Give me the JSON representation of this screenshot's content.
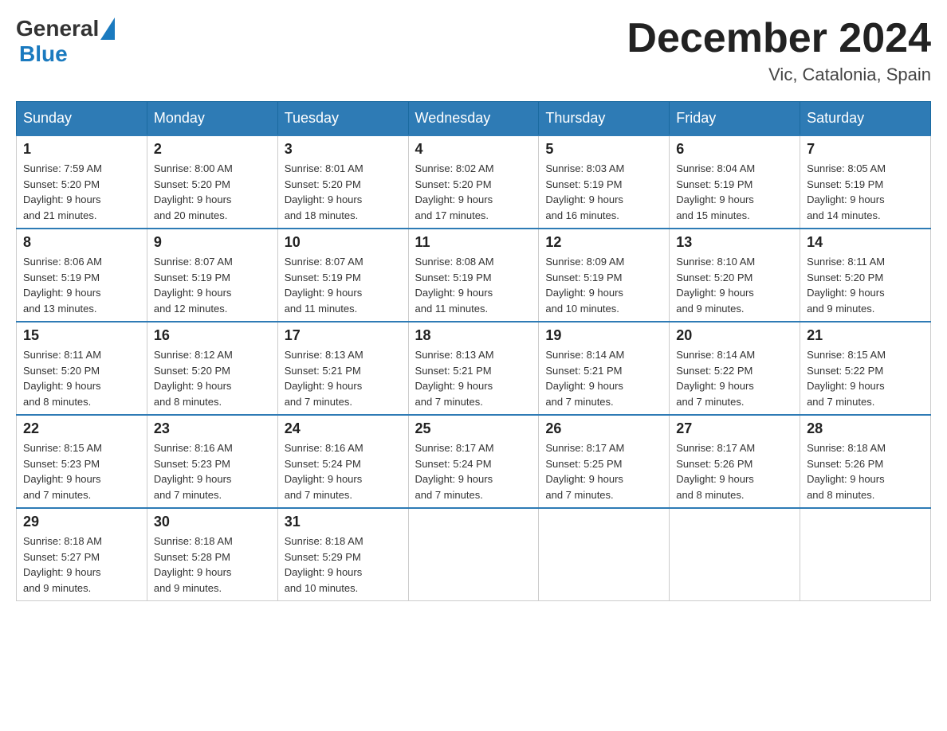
{
  "header": {
    "logo_general": "General",
    "logo_blue": "Blue",
    "month_title": "December 2024",
    "subtitle": "Vic, Catalonia, Spain"
  },
  "weekdays": [
    "Sunday",
    "Monday",
    "Tuesday",
    "Wednesday",
    "Thursday",
    "Friday",
    "Saturday"
  ],
  "weeks": [
    [
      {
        "day": "1",
        "sunrise": "7:59 AM",
        "sunset": "5:20 PM",
        "daylight": "9 hours and 21 minutes."
      },
      {
        "day": "2",
        "sunrise": "8:00 AM",
        "sunset": "5:20 PM",
        "daylight": "9 hours and 20 minutes."
      },
      {
        "day": "3",
        "sunrise": "8:01 AM",
        "sunset": "5:20 PM",
        "daylight": "9 hours and 18 minutes."
      },
      {
        "day": "4",
        "sunrise": "8:02 AM",
        "sunset": "5:20 PM",
        "daylight": "9 hours and 17 minutes."
      },
      {
        "day": "5",
        "sunrise": "8:03 AM",
        "sunset": "5:19 PM",
        "daylight": "9 hours and 16 minutes."
      },
      {
        "day": "6",
        "sunrise": "8:04 AM",
        "sunset": "5:19 PM",
        "daylight": "9 hours and 15 minutes."
      },
      {
        "day": "7",
        "sunrise": "8:05 AM",
        "sunset": "5:19 PM",
        "daylight": "9 hours and 14 minutes."
      }
    ],
    [
      {
        "day": "8",
        "sunrise": "8:06 AM",
        "sunset": "5:19 PM",
        "daylight": "9 hours and 13 minutes."
      },
      {
        "day": "9",
        "sunrise": "8:07 AM",
        "sunset": "5:19 PM",
        "daylight": "9 hours and 12 minutes."
      },
      {
        "day": "10",
        "sunrise": "8:07 AM",
        "sunset": "5:19 PM",
        "daylight": "9 hours and 11 minutes."
      },
      {
        "day": "11",
        "sunrise": "8:08 AM",
        "sunset": "5:19 PM",
        "daylight": "9 hours and 11 minutes."
      },
      {
        "day": "12",
        "sunrise": "8:09 AM",
        "sunset": "5:19 PM",
        "daylight": "9 hours and 10 minutes."
      },
      {
        "day": "13",
        "sunrise": "8:10 AM",
        "sunset": "5:20 PM",
        "daylight": "9 hours and 9 minutes."
      },
      {
        "day": "14",
        "sunrise": "8:11 AM",
        "sunset": "5:20 PM",
        "daylight": "9 hours and 9 minutes."
      }
    ],
    [
      {
        "day": "15",
        "sunrise": "8:11 AM",
        "sunset": "5:20 PM",
        "daylight": "9 hours and 8 minutes."
      },
      {
        "day": "16",
        "sunrise": "8:12 AM",
        "sunset": "5:20 PM",
        "daylight": "9 hours and 8 minutes."
      },
      {
        "day": "17",
        "sunrise": "8:13 AM",
        "sunset": "5:21 PM",
        "daylight": "9 hours and 7 minutes."
      },
      {
        "day": "18",
        "sunrise": "8:13 AM",
        "sunset": "5:21 PM",
        "daylight": "9 hours and 7 minutes."
      },
      {
        "day": "19",
        "sunrise": "8:14 AM",
        "sunset": "5:21 PM",
        "daylight": "9 hours and 7 minutes."
      },
      {
        "day": "20",
        "sunrise": "8:14 AM",
        "sunset": "5:22 PM",
        "daylight": "9 hours and 7 minutes."
      },
      {
        "day": "21",
        "sunrise": "8:15 AM",
        "sunset": "5:22 PM",
        "daylight": "9 hours and 7 minutes."
      }
    ],
    [
      {
        "day": "22",
        "sunrise": "8:15 AM",
        "sunset": "5:23 PM",
        "daylight": "9 hours and 7 minutes."
      },
      {
        "day": "23",
        "sunrise": "8:16 AM",
        "sunset": "5:23 PM",
        "daylight": "9 hours and 7 minutes."
      },
      {
        "day": "24",
        "sunrise": "8:16 AM",
        "sunset": "5:24 PM",
        "daylight": "9 hours and 7 minutes."
      },
      {
        "day": "25",
        "sunrise": "8:17 AM",
        "sunset": "5:24 PM",
        "daylight": "9 hours and 7 minutes."
      },
      {
        "day": "26",
        "sunrise": "8:17 AM",
        "sunset": "5:25 PM",
        "daylight": "9 hours and 7 minutes."
      },
      {
        "day": "27",
        "sunrise": "8:17 AM",
        "sunset": "5:26 PM",
        "daylight": "9 hours and 8 minutes."
      },
      {
        "day": "28",
        "sunrise": "8:18 AM",
        "sunset": "5:26 PM",
        "daylight": "9 hours and 8 minutes."
      }
    ],
    [
      {
        "day": "29",
        "sunrise": "8:18 AM",
        "sunset": "5:27 PM",
        "daylight": "9 hours and 9 minutes."
      },
      {
        "day": "30",
        "sunrise": "8:18 AM",
        "sunset": "5:28 PM",
        "daylight": "9 hours and 9 minutes."
      },
      {
        "day": "31",
        "sunrise": "8:18 AM",
        "sunset": "5:29 PM",
        "daylight": "9 hours and 10 minutes."
      },
      null,
      null,
      null,
      null
    ]
  ],
  "labels": {
    "sunrise": "Sunrise:",
    "sunset": "Sunset:",
    "daylight": "Daylight:"
  }
}
